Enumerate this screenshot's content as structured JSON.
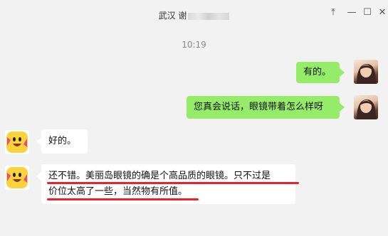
{
  "header": {
    "title_prefix": "武汉 谢",
    "title_suffix": "",
    "controls": {
      "pin": "⤒",
      "minimize": "—",
      "maximize": "☐",
      "close": "✕"
    }
  },
  "timestamp": "10:19",
  "messages": [
    {
      "sender": "self",
      "text": "有的。"
    },
    {
      "sender": "self",
      "text": "您真会说话，眼镜带着怎么样呀"
    },
    {
      "sender": "other",
      "text": "好的。"
    },
    {
      "sender": "other",
      "line1": "还不错。美丽岛眼镜的确是个高品质的眼镜。只不过是",
      "line2": "价位太高了一些，当然物有所值。"
    }
  ],
  "colors": {
    "self_bubble": "#95ec69",
    "other_bubble": "#ffffff",
    "annotation": "#e8232d"
  }
}
